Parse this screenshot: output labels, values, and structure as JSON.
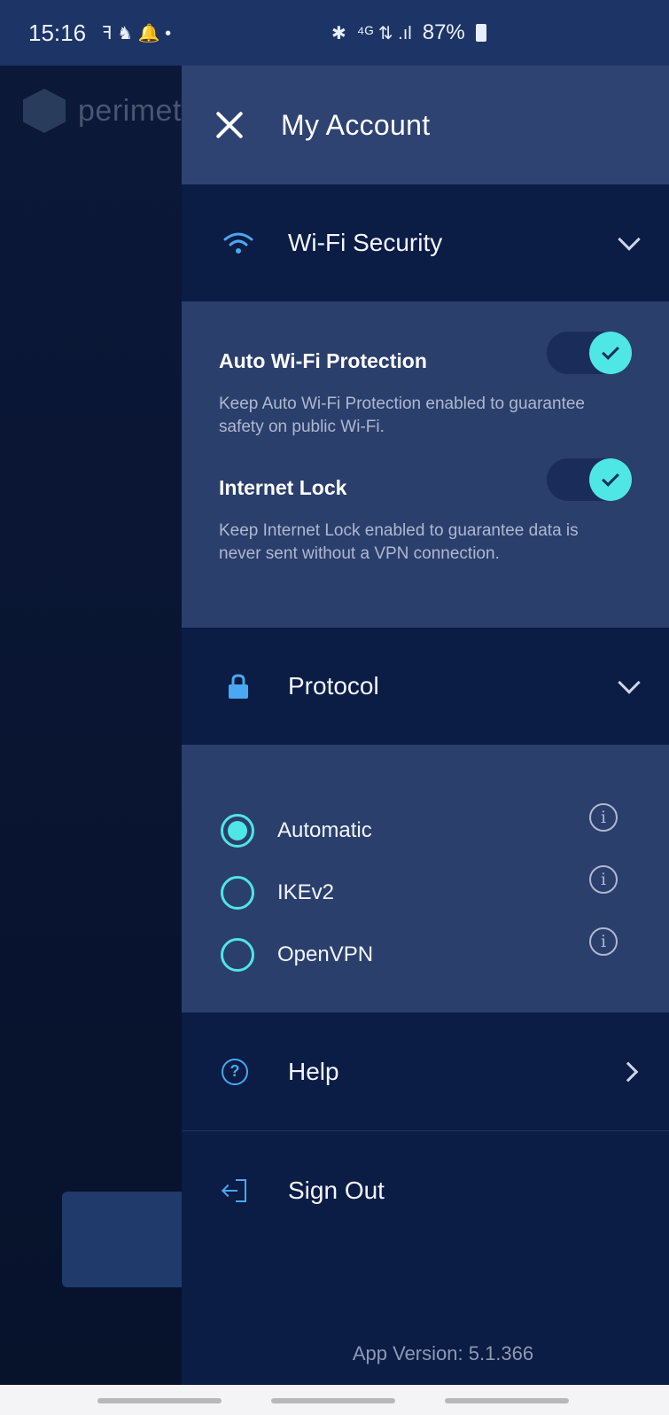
{
  "status_bar": {
    "time": "15:16",
    "battery": "87%"
  },
  "background_app": {
    "logo_text": "perimet"
  },
  "drawer": {
    "title": "My Account",
    "wifi_section": {
      "label": "Wi-Fi Security",
      "settings": [
        {
          "title": "Auto Wi-Fi Protection",
          "description": "Keep Auto Wi-Fi Protection enabled to guarantee safety on public Wi-Fi.",
          "enabled": true
        },
        {
          "title": "Internet Lock",
          "description": "Keep Internet Lock enabled to guarantee data is never sent without a VPN connection.",
          "enabled": true
        }
      ]
    },
    "protocol_section": {
      "label": "Protocol",
      "options": [
        {
          "label": "Automatic",
          "selected": true
        },
        {
          "label": "IKEv2",
          "selected": false
        },
        {
          "label": "OpenVPN",
          "selected": false
        }
      ]
    },
    "help": {
      "label": "Help"
    },
    "sign_out": {
      "label": "Sign Out"
    },
    "app_version": "App Version: 5.1.366"
  },
  "colors": {
    "accent": "#4fe6e6",
    "drawer_bg": "#2b3f6d",
    "section_bg": "#0b1c45",
    "icon_blue": "#4aa8f0"
  }
}
